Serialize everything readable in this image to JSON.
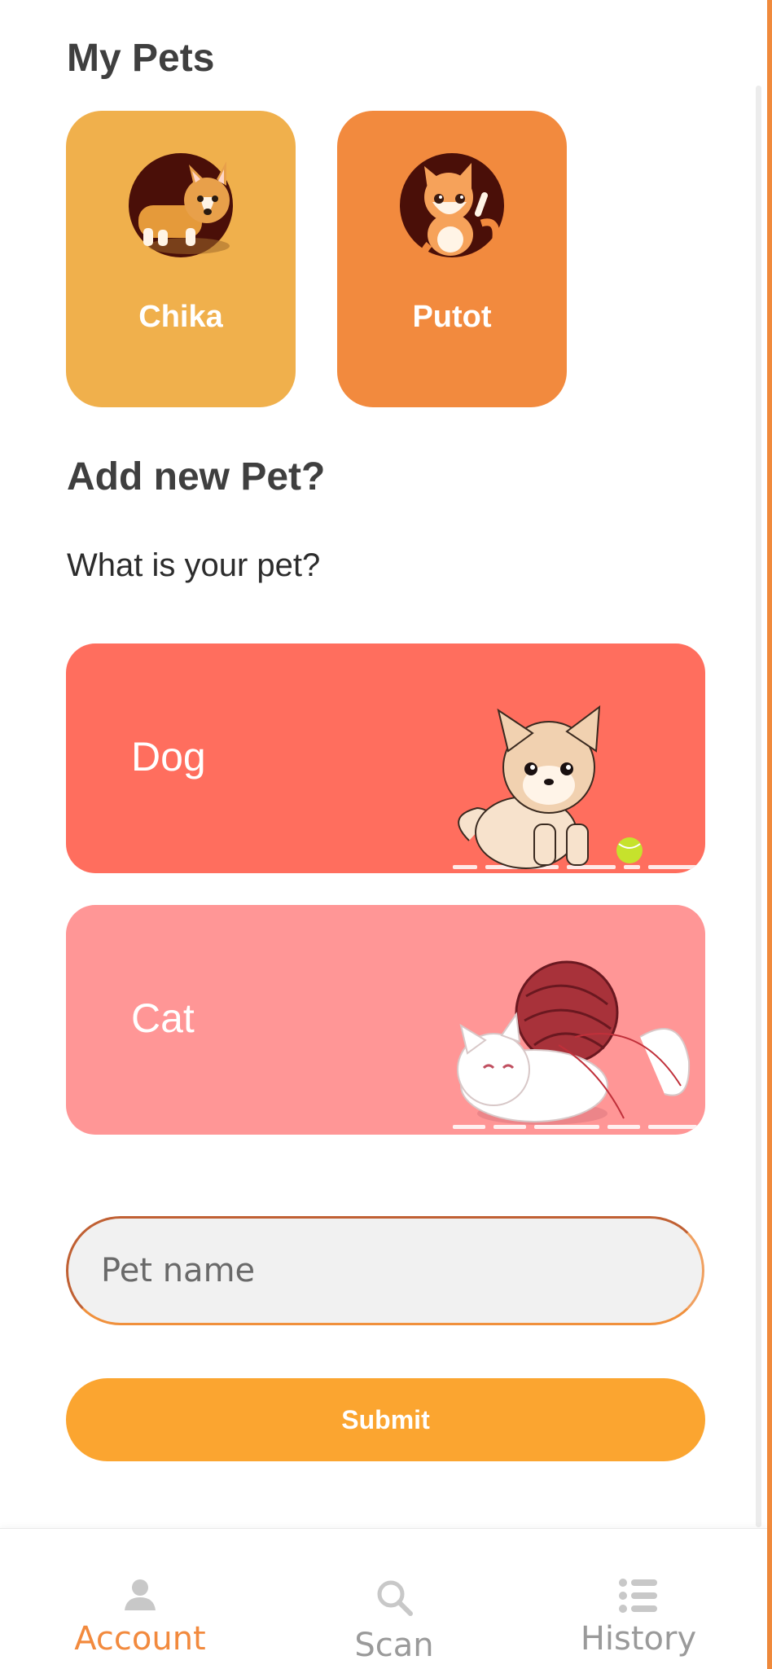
{
  "page": {
    "title": "My Pets"
  },
  "pets": [
    {
      "name": "Chika",
      "color": "#f0b04c",
      "avatar_icon": "corgi-avatar-icon"
    },
    {
      "name": "Putot",
      "color": "#f28a3e",
      "avatar_icon": "kitten-avatar-icon"
    }
  ],
  "add_section": {
    "title": "Add new Pet?",
    "question": "What is your pet?",
    "choices": [
      {
        "label": "Dog",
        "color": "#ff6e5e"
      },
      {
        "label": "Cat",
        "color": "#ff9696"
      }
    ]
  },
  "form": {
    "pet_name_placeholder": "Pet name",
    "pet_name_value": "",
    "submit_label": "Submit"
  },
  "nav": {
    "items": [
      {
        "label": "Account",
        "icon": "person-icon",
        "active": true,
        "color": "#f28a3e"
      },
      {
        "label": "Scan",
        "icon": "search-icon",
        "active": false,
        "color": "#9a9a9a"
      },
      {
        "label": "History",
        "icon": "list-icon",
        "active": false,
        "color": "#9a9a9a"
      }
    ]
  }
}
